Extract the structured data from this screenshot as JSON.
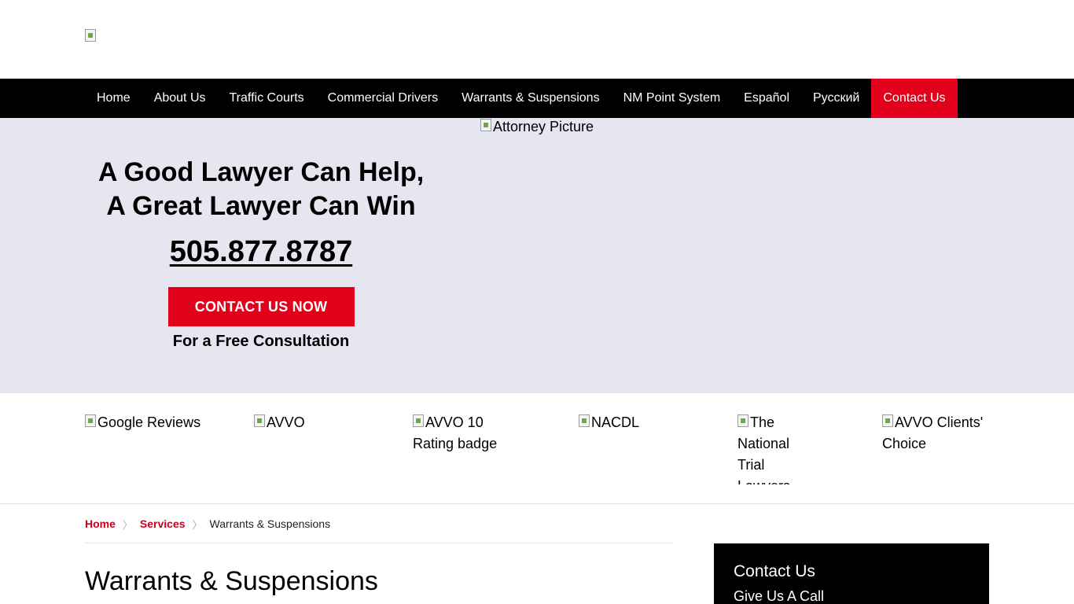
{
  "header": {
    "logo_alt": ""
  },
  "nav": {
    "items": [
      {
        "label": "Home"
      },
      {
        "label": "About Us"
      },
      {
        "label": "Traffic Courts"
      },
      {
        "label": "Commercial Drivers"
      },
      {
        "label": "Warrants & Suspensions"
      },
      {
        "label": "NM Point System"
      },
      {
        "label": "Español"
      },
      {
        "label": "Русский"
      },
      {
        "label": "Contact Us"
      }
    ],
    "active_index": 8
  },
  "hero": {
    "title_line1": "A Good Lawyer Can Help,",
    "title_line2": "A Great Lawyer Can Win",
    "phone": "505.877.8787",
    "cta_label": "CONTACT US NOW",
    "cta_sub": "For a Free Consultation",
    "attorney_alt": "Attorney Picture"
  },
  "badges": [
    {
      "alt": "Google Reviews"
    },
    {
      "alt": "AVVO"
    },
    {
      "alt": "AVVO 10 Rating badge"
    },
    {
      "alt": "NACDL"
    },
    {
      "alt": "The National Trial Lawyers"
    },
    {
      "alt": "AVVO Clients' Choice"
    }
  ],
  "breadcrumb": {
    "home": "Home",
    "services": "Services",
    "current": "Warrants & Suspensions"
  },
  "page": {
    "heading": "Warrants & Suspensions"
  },
  "sidebar": {
    "title": "Contact Us",
    "subtitle": "Give Us A Call"
  },
  "colors": {
    "accent": "#e2001a",
    "hero_bg": "#e6e6f1",
    "nav_bg": "#000000"
  }
}
